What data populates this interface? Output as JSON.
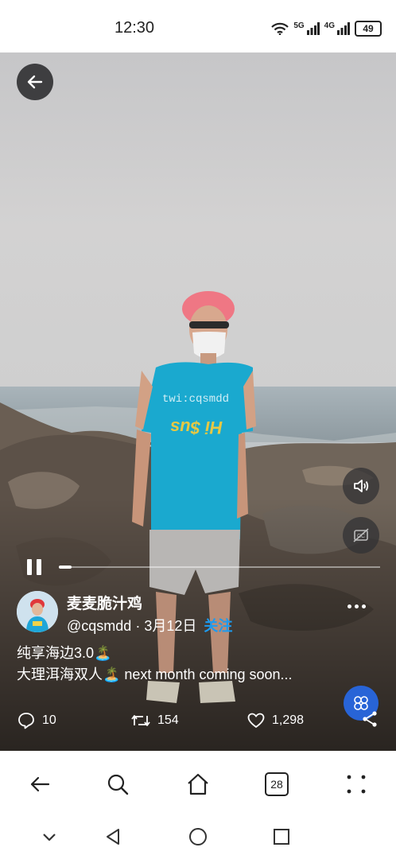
{
  "status_bar": {
    "time": "12:30",
    "signal_1_label": "5G",
    "signal_2_label": "4G",
    "battery": "49"
  },
  "post": {
    "display_name": "麦麦脆汁鸡",
    "handle": "@cqsmdd",
    "separator": " · ",
    "date": "3月12日",
    "follow_label": "关注",
    "caption_line1": "纯享海边3.0🏝️",
    "caption_line2": "大理洱海双人🏝️ next month coming soon...",
    "watermark": "twi:cqsmdd",
    "shirt_text": "Hi $us",
    "replies": "10",
    "reposts": "154",
    "likes": "1,298"
  },
  "video": {
    "progress_fraction": 0.04,
    "playing": true
  },
  "browser": {
    "tab_count": "28"
  },
  "colors": {
    "accent": "#1d9bf0",
    "fab": "#2864d7",
    "shirt": "#19a9cf",
    "hair": "#f27a86"
  }
}
